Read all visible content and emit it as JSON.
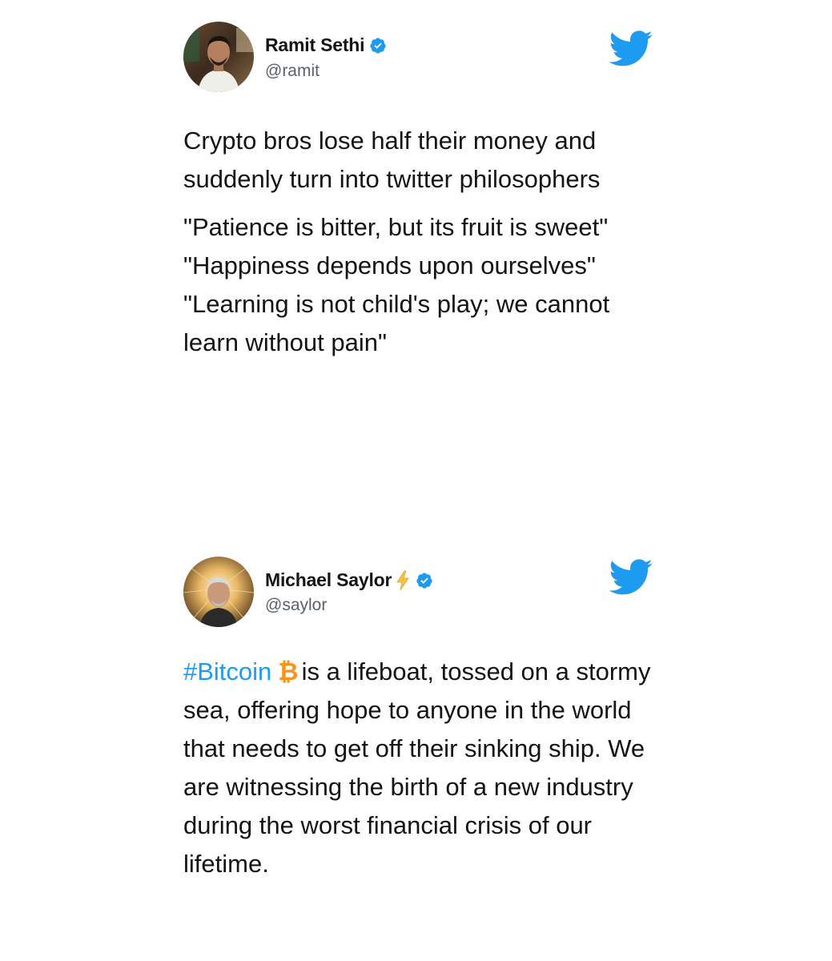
{
  "tweets": [
    {
      "display_name": "Ramit Sethi",
      "handle": "@ramit",
      "verified": true,
      "avatar_icon": "profile-photo",
      "paragraphs": [
        "Crypto bros lose half their money and suddenly turn into twitter philosophers",
        "\"Patience is bitter, but its fruit is sweet\"",
        "\"Happiness depends upon ourselves\"",
        "\"Learning is not child's play; we cannot learn without pain\""
      ]
    },
    {
      "display_name": "Michael Saylor",
      "name_emoji": "⚡",
      "handle": "@saylor",
      "verified": true,
      "avatar_icon": "profile-photo",
      "hashtag": "#Bitcoin",
      "hashtag_emoji": "₿",
      "body_after_hashtag": "is a lifeboat, tossed on a stormy sea, offering hope to anyone in the world that needs to get off their sinking ship. We are witnessing the birth of a new industry during the worst financial crisis of our lifetime."
    }
  ],
  "colors": {
    "twitter_blue": "#1d9bf0",
    "text": "#141414",
    "handle": "#5b6168",
    "bitcoin_orange": "#f7931a",
    "lightning_yellow": "#f6c244"
  },
  "icons": {
    "brand": "twitter-bird-icon",
    "verified": "verified-badge-icon"
  }
}
